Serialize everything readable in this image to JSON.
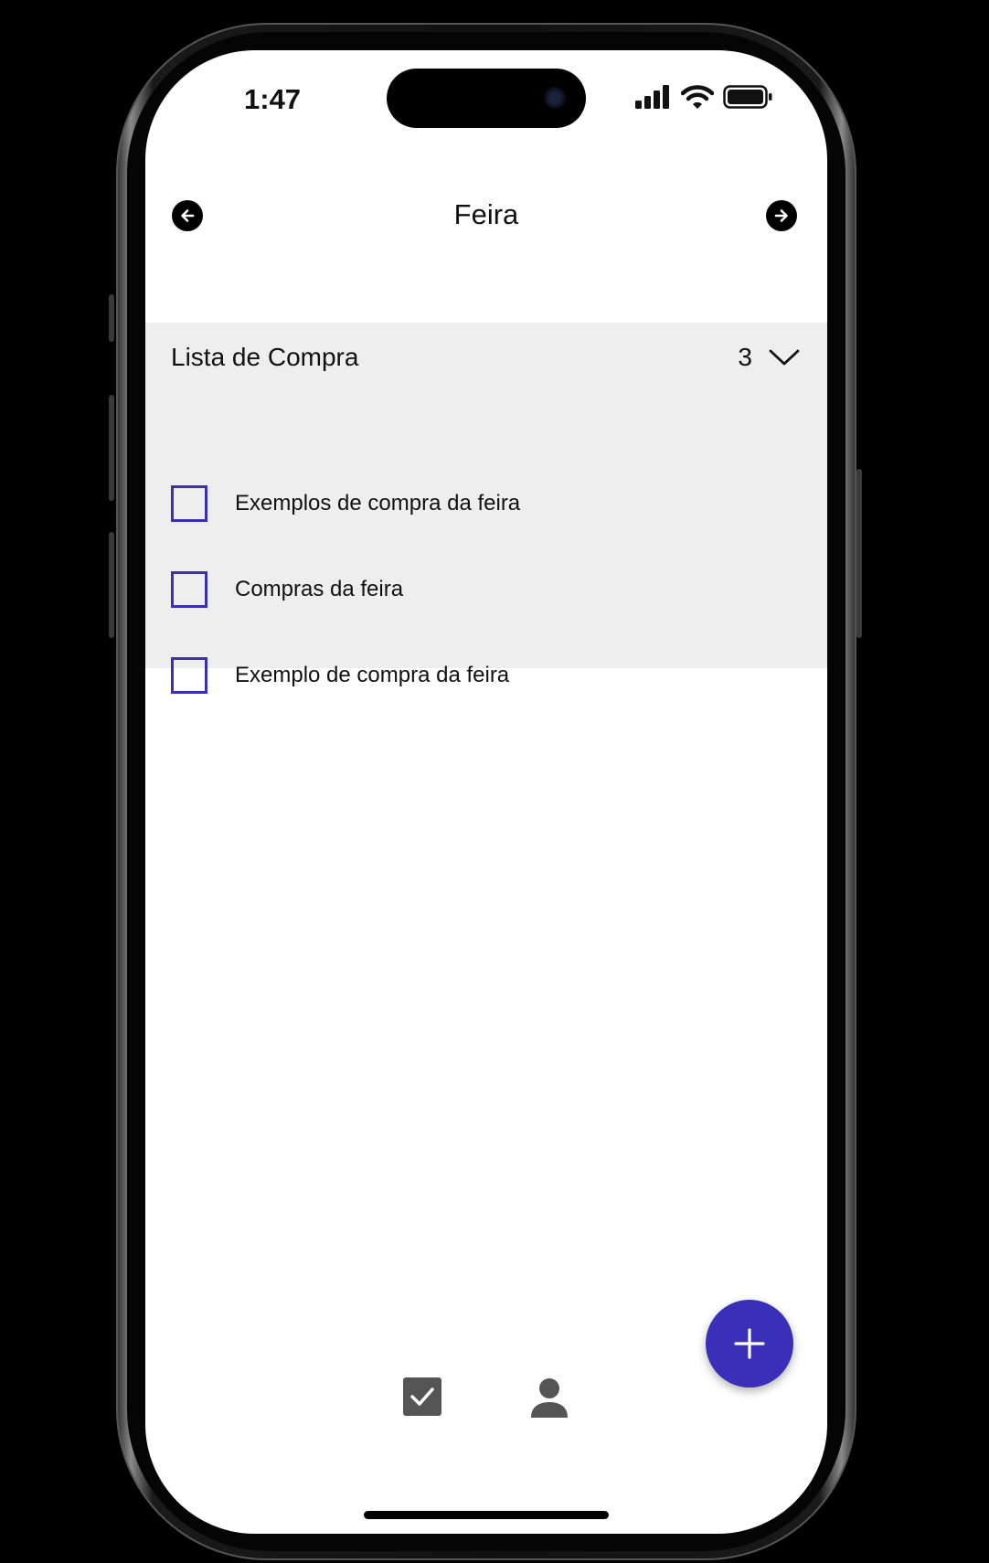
{
  "status_bar": {
    "time": "1:47"
  },
  "header": {
    "title": "Feira",
    "back_icon": "arrow-left-circle-icon",
    "forward_icon": "arrow-right-circle-icon"
  },
  "list": {
    "title": "Lista de Compra",
    "count": "3",
    "items": [
      {
        "label": "Exemplos de compra da feira",
        "checked": false
      },
      {
        "label": "Compras da feira",
        "checked": false
      },
      {
        "label": "Exemplo de compra da feira",
        "checked": false
      }
    ]
  },
  "fab": {
    "icon": "plus-icon"
  },
  "bottom_nav": {
    "items": [
      {
        "icon": "checkbox-checked-icon"
      },
      {
        "icon": "person-icon"
      }
    ]
  },
  "colors": {
    "accent": "#3a2fb8",
    "panel_background": "#eeeeee"
  }
}
